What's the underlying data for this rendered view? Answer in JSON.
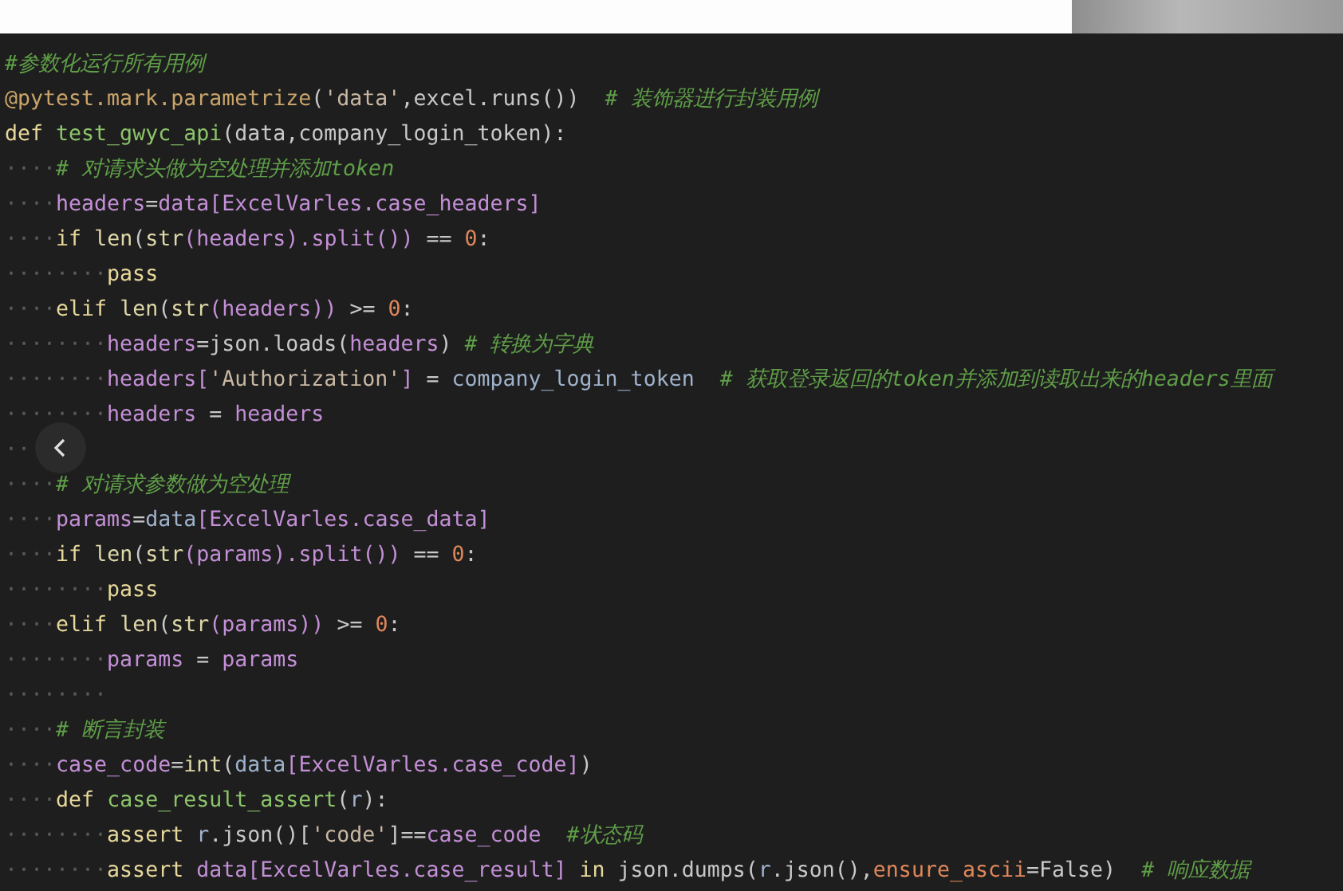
{
  "lines": [
    {
      "tokens": [
        {
          "kind": "comment",
          "text": "#参数化运行所有用例"
        }
      ]
    },
    {
      "tokens": [
        {
          "kind": "decorator",
          "text": "@pytest.mark.parametrize"
        },
        {
          "kind": "plain",
          "text": "("
        },
        {
          "kind": "string",
          "text": "'data'"
        },
        {
          "kind": "plain",
          "text": ",excel.runs())  "
        },
        {
          "kind": "comment",
          "text": "# 装饰器进行封装用例"
        }
      ]
    },
    {
      "tokens": [
        {
          "kind": "keyword",
          "text": "def "
        },
        {
          "kind": "func",
          "text": "test_gwyc_api"
        },
        {
          "kind": "plain",
          "text": "(data,company_login_token):"
        }
      ]
    },
    {
      "tokens": [
        {
          "kind": "indent",
          "text": "····"
        },
        {
          "kind": "comment",
          "text": "# 对请求头做为空处理并添加token"
        }
      ]
    },
    {
      "tokens": [
        {
          "kind": "indent",
          "text": "····"
        },
        {
          "kind": "var",
          "text": "headers"
        },
        {
          "kind": "plain",
          "text": "="
        },
        {
          "kind": "var",
          "text": "data[ExcelVarles.case_headers]"
        }
      ]
    },
    {
      "tokens": [
        {
          "kind": "indent",
          "text": "····"
        },
        {
          "kind": "keyword",
          "text": "if "
        },
        {
          "kind": "builtin",
          "text": "len"
        },
        {
          "kind": "plain",
          "text": "("
        },
        {
          "kind": "builtin",
          "text": "str"
        },
        {
          "kind": "var",
          "text": "(headers).split())"
        },
        {
          "kind": "plain",
          "text": " == "
        },
        {
          "kind": "number",
          "text": "0"
        },
        {
          "kind": "plain",
          "text": ":"
        }
      ]
    },
    {
      "tokens": [
        {
          "kind": "indent",
          "text": "········"
        },
        {
          "kind": "keyword",
          "text": "pass"
        }
      ]
    },
    {
      "tokens": [
        {
          "kind": "indent",
          "text": "····"
        },
        {
          "kind": "keyword",
          "text": "elif "
        },
        {
          "kind": "builtin",
          "text": "len"
        },
        {
          "kind": "plain",
          "text": "("
        },
        {
          "kind": "builtin",
          "text": "str"
        },
        {
          "kind": "var",
          "text": "(headers))"
        },
        {
          "kind": "plain",
          "text": " >= "
        },
        {
          "kind": "number",
          "text": "0"
        },
        {
          "kind": "plain",
          "text": ":"
        }
      ]
    },
    {
      "tokens": [
        {
          "kind": "indent",
          "text": "········"
        },
        {
          "kind": "var",
          "text": "headers"
        },
        {
          "kind": "plain",
          "text": "=json.loads("
        },
        {
          "kind": "var",
          "text": "headers"
        },
        {
          "kind": "plain",
          "text": ") "
        },
        {
          "kind": "comment",
          "text": "# 转换为字典"
        }
      ]
    },
    {
      "tokens": [
        {
          "kind": "indent",
          "text": "········"
        },
        {
          "kind": "var",
          "text": "headers["
        },
        {
          "kind": "string",
          "text": "'Authorization'"
        },
        {
          "kind": "var",
          "text": "]"
        },
        {
          "kind": "plain",
          "text": " = "
        },
        {
          "kind": "param",
          "text": "company_login_token  "
        },
        {
          "kind": "comment",
          "text": "# 获取登录返回的token并添加到读取出来的headers里面"
        }
      ]
    },
    {
      "tokens": [
        {
          "kind": "indent",
          "text": "········"
        },
        {
          "kind": "var",
          "text": "headers"
        },
        {
          "kind": "plain",
          "text": " = "
        },
        {
          "kind": "var",
          "text": "headers"
        }
      ]
    },
    {
      "tokens": [
        {
          "kind": "indent",
          "text": "··"
        }
      ]
    },
    {
      "tokens": [
        {
          "kind": "indent",
          "text": "····"
        },
        {
          "kind": "comment",
          "text": "# 对请求参数做为空处理"
        }
      ]
    },
    {
      "tokens": [
        {
          "kind": "indent",
          "text": "····"
        },
        {
          "kind": "var",
          "text": "params"
        },
        {
          "kind": "plain",
          "text": "="
        },
        {
          "kind": "param",
          "text": "data"
        },
        {
          "kind": "var",
          "text": "[ExcelVarles.case_data]"
        }
      ]
    },
    {
      "tokens": [
        {
          "kind": "indent",
          "text": "····"
        },
        {
          "kind": "keyword",
          "text": "if "
        },
        {
          "kind": "builtin",
          "text": "len"
        },
        {
          "kind": "plain",
          "text": "("
        },
        {
          "kind": "builtin",
          "text": "str"
        },
        {
          "kind": "var",
          "text": "(params).split())"
        },
        {
          "kind": "plain",
          "text": " == "
        },
        {
          "kind": "number",
          "text": "0"
        },
        {
          "kind": "plain",
          "text": ":"
        }
      ]
    },
    {
      "tokens": [
        {
          "kind": "indent",
          "text": "········"
        },
        {
          "kind": "keyword",
          "text": "pass"
        }
      ]
    },
    {
      "tokens": [
        {
          "kind": "indent",
          "text": "····"
        },
        {
          "kind": "keyword",
          "text": "elif "
        },
        {
          "kind": "builtin",
          "text": "len"
        },
        {
          "kind": "plain",
          "text": "("
        },
        {
          "kind": "builtin",
          "text": "str"
        },
        {
          "kind": "var",
          "text": "(params))"
        },
        {
          "kind": "plain",
          "text": " >= "
        },
        {
          "kind": "number",
          "text": "0"
        },
        {
          "kind": "plain",
          "text": ":"
        }
      ]
    },
    {
      "tokens": [
        {
          "kind": "indent",
          "text": "········"
        },
        {
          "kind": "var",
          "text": "params"
        },
        {
          "kind": "plain",
          "text": " = "
        },
        {
          "kind": "var",
          "text": "params"
        }
      ]
    },
    {
      "tokens": [
        {
          "kind": "indent",
          "text": "········"
        }
      ]
    },
    {
      "tokens": [
        {
          "kind": "indent",
          "text": "····"
        },
        {
          "kind": "comment",
          "text": "# 断言封装"
        }
      ]
    },
    {
      "tokens": [
        {
          "kind": "indent",
          "text": "····"
        },
        {
          "kind": "var",
          "text": "case_code"
        },
        {
          "kind": "plain",
          "text": "="
        },
        {
          "kind": "builtin",
          "text": "int"
        },
        {
          "kind": "plain",
          "text": "("
        },
        {
          "kind": "param",
          "text": "data"
        },
        {
          "kind": "var",
          "text": "[ExcelVarles.case_code]"
        },
        {
          "kind": "plain",
          "text": ")"
        }
      ]
    },
    {
      "tokens": [
        {
          "kind": "indent",
          "text": "····"
        },
        {
          "kind": "keyword",
          "text": "def "
        },
        {
          "kind": "func",
          "text": "case_result_assert"
        },
        {
          "kind": "plain",
          "text": "("
        },
        {
          "kind": "param",
          "text": "r"
        },
        {
          "kind": "plain",
          "text": "):"
        }
      ]
    },
    {
      "tokens": [
        {
          "kind": "indent",
          "text": "········"
        },
        {
          "kind": "keyword",
          "text": "assert "
        },
        {
          "kind": "param",
          "text": "r"
        },
        {
          "kind": "plain",
          "text": ".json()["
        },
        {
          "kind": "string",
          "text": "'code'"
        },
        {
          "kind": "plain",
          "text": "]=="
        },
        {
          "kind": "var",
          "text": "case_code  "
        },
        {
          "kind": "comment",
          "text": "#状态码"
        }
      ]
    },
    {
      "tokens": [
        {
          "kind": "indent",
          "text": "········"
        },
        {
          "kind": "keyword",
          "text": "assert "
        },
        {
          "kind": "var",
          "text": "data[ExcelVarles.case_result]"
        },
        {
          "kind": "keyword",
          "text": " in "
        },
        {
          "kind": "plain",
          "text": "json.dumps("
        },
        {
          "kind": "param",
          "text": "r"
        },
        {
          "kind": "plain",
          "text": ".json(),"
        },
        {
          "kind": "number",
          "text": "ensure_ascii"
        },
        {
          "kind": "plain",
          "text": "=False)  "
        },
        {
          "kind": "comment",
          "text": "# 响应数据"
        }
      ]
    }
  ]
}
